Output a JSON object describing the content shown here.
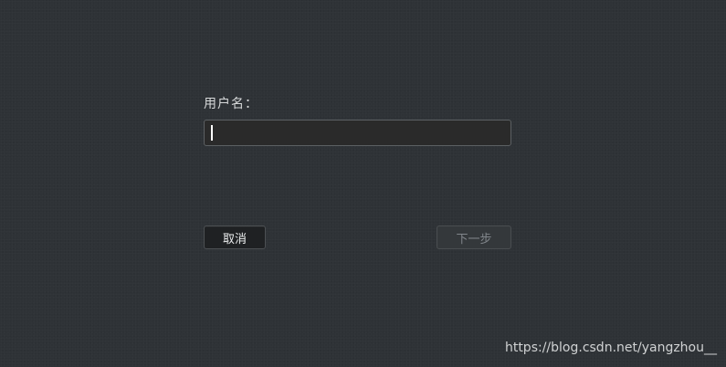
{
  "form": {
    "username_label": "用户名：",
    "username_value": "",
    "cancel_label": "取消",
    "next_label": "下一步",
    "next_enabled": false
  },
  "watermark": "https://blog.csdn.net/yangzhou__",
  "colors": {
    "background": "#2e3236",
    "input_background": "#2a2a2a",
    "text": "#d7d9da",
    "disabled_text": "#80858a"
  }
}
